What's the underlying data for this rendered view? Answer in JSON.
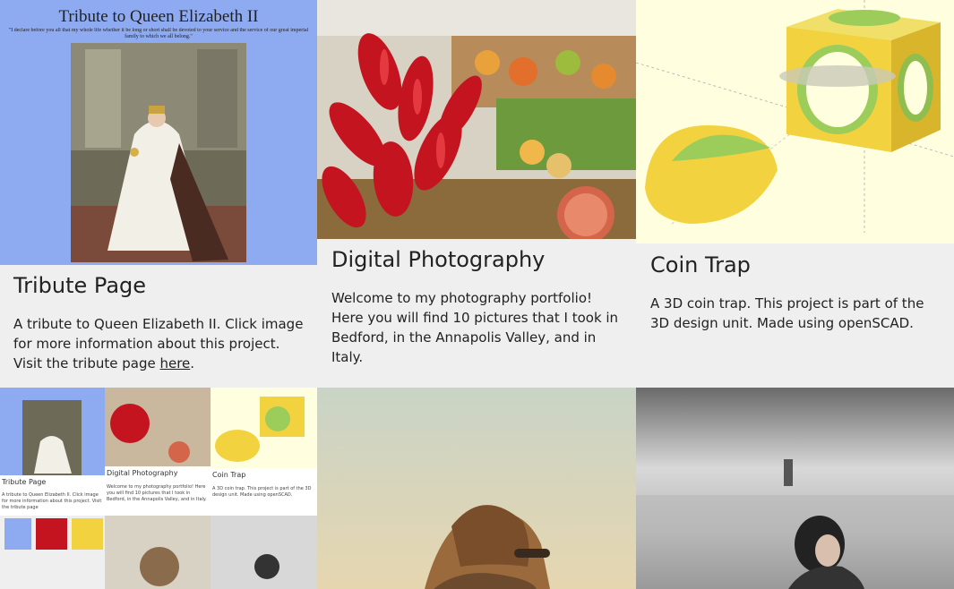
{
  "cards": [
    {
      "title": "Tribute Page",
      "image_heading": "Tribute to Queen Elizabeth II",
      "image_quote": "\"I declare before you all that my whole life whether it be long or short shall be devoted to your service and the service of our great imperial family to which we all belong.\"",
      "text_before": "A tribute to Queen Elizabeth II. Click image for more information about this project. Visit the tribute page ",
      "link": "here",
      "text_after": "."
    },
    {
      "title": "Digital Photography",
      "text": "Welcome to my photography portfolio! Here you will find 10 pictures that I took in Bedford, in the Annapolis Valley, and in Italy."
    },
    {
      "title": "Coin Trap",
      "text": "A 3D coin trap. This project is part of the 3D design unit. Made using openSCAD."
    }
  ],
  "thumbnail": {
    "labels": [
      "Tribute Page",
      "Digital Photography",
      "Coin Trap"
    ]
  },
  "colors": {
    "card_bg": "#efefef",
    "tribute_bg": "#8eaaf0",
    "coin_bg": "#ffffe0",
    "coin_yellow": "#f2d33f",
    "coin_green": "#9ccc5a",
    "pepper_red": "#c4141f"
  }
}
